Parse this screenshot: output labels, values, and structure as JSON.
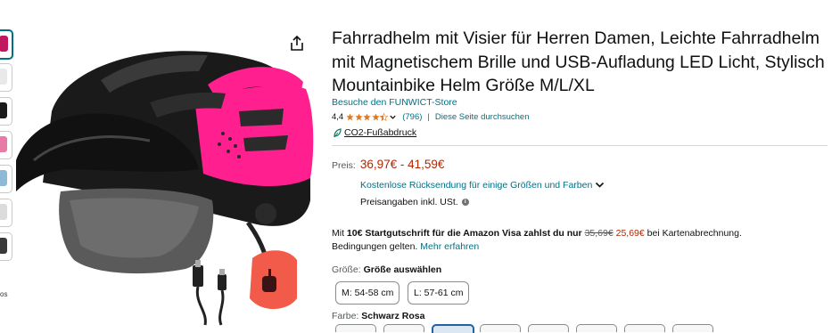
{
  "gallery": {
    "thumbnails": [
      {
        "color": "#c0185f"
      },
      {
        "color": "#e9e9e9"
      },
      {
        "color": "#1b1b1b"
      },
      {
        "color": "#e87aa6"
      },
      {
        "color": "#8db9d8"
      },
      {
        "color": "#dcdcdc"
      },
      {
        "color": "#3a3a3a"
      }
    ],
    "thumb_extra_label": "os"
  },
  "product": {
    "title_lines": [
      "Fahrradhelm mit Visier für Herren Damen, Leichte Fahrradhelm",
      "mit Magnetischem Brille und USB-Aufladung LED Licht, Stylisch",
      "Mountainbike Helm Größe M/L/XL"
    ],
    "store_link": "Besuche den FUNWICT-Store",
    "rating_value": "4,4",
    "rating_stars": 4.4,
    "rating_count": "(796)",
    "separator": "|",
    "search_link": "Diese Seite durchsuchen",
    "co2_label": "CO2-Fußabdruck"
  },
  "pricing": {
    "label": "Preis:",
    "range": "36,97€ - 41,59€",
    "shipping": "Kostenlose Rücksendung für einige Größen und Farben",
    "tax": "Preisangaben inkl. USt.",
    "info_icon": "i"
  },
  "promo": {
    "prefix": "Mit ",
    "bold": "10€ Startgutschrift für die Amazon Visa zahlst du nur",
    "old_price": "35,69€",
    "new_price": "25,69€",
    "suffix": " bei Kartenabrechnung.",
    "line2": "Bedingungen gelten. ",
    "more_link": "Mehr erfahren"
  },
  "size": {
    "label": "Größe:",
    "selected": "Größe auswählen",
    "options": [
      "M: 54-58 cm",
      "L: 57-61 cm"
    ]
  },
  "color": {
    "label": "Farbe:",
    "selected": "Schwarz Rosa",
    "accent": "#2162a1"
  },
  "colors": {
    "price_red": "#b12704",
    "link_teal": "#007185",
    "helmet_pink": "#ff1f8e"
  }
}
